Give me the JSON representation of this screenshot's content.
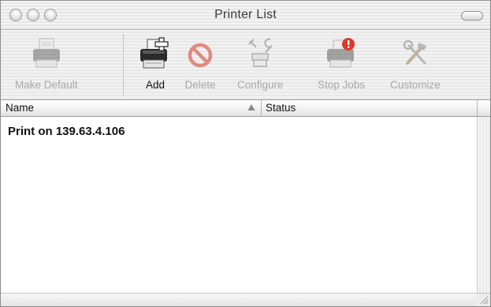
{
  "window": {
    "title": "Printer List"
  },
  "toolbar": {
    "items": [
      {
        "label": "Make Default",
        "icon": "printer-default-icon",
        "enabled": false
      },
      {
        "label": "Add",
        "icon": "printer-add-icon",
        "enabled": true
      },
      {
        "label": "Delete",
        "icon": "delete-icon",
        "enabled": false
      },
      {
        "label": "Configure",
        "icon": "configure-icon",
        "enabled": false
      },
      {
        "label": "Stop Jobs",
        "icon": "stop-jobs-icon",
        "enabled": false
      },
      {
        "label": "Customize",
        "icon": "customize-icon",
        "enabled": false
      }
    ]
  },
  "list": {
    "columns": [
      "Name",
      "Status"
    ],
    "sort_indicator": "ascending",
    "rows": [
      {
        "name": "Print on 139.63.4.106",
        "status": ""
      }
    ]
  },
  "colors": {
    "disabled_text": "#a8a8a8",
    "enabled_text": "#111111",
    "alert_red": "#d93a2b"
  }
}
